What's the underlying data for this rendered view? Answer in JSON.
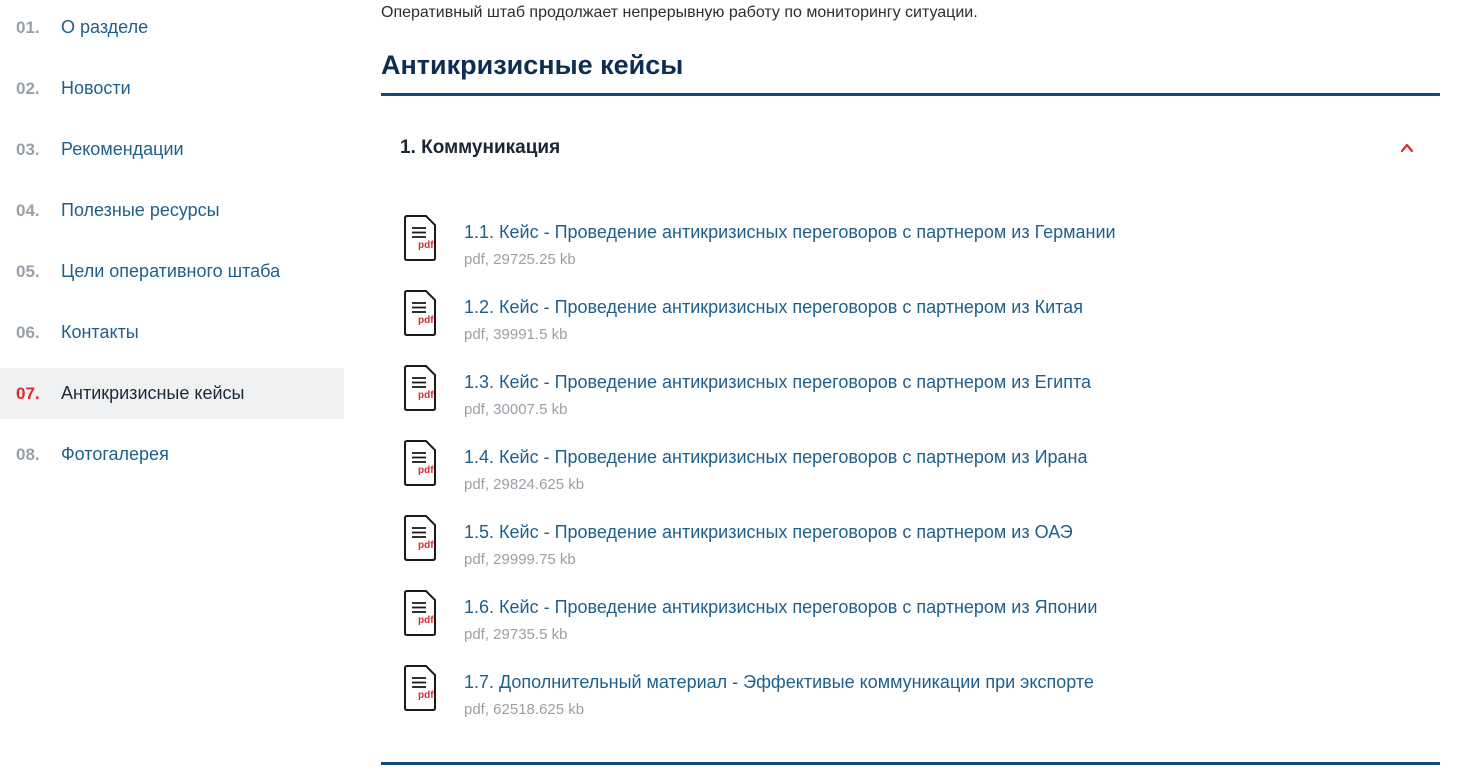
{
  "sidebar": {
    "items": [
      {
        "num": "01.",
        "label": "О разделе"
      },
      {
        "num": "02.",
        "label": "Новости"
      },
      {
        "num": "03.",
        "label": "Рекомендации"
      },
      {
        "num": "04.",
        "label": "Полезные ресурсы"
      },
      {
        "num": "05.",
        "label": "Цели оперативного штаба"
      },
      {
        "num": "06.",
        "label": "Контакты"
      },
      {
        "num": "07.",
        "label": "Антикризисные кейсы"
      },
      {
        "num": "08.",
        "label": "Фотогалерея"
      }
    ],
    "active_index": 6
  },
  "main": {
    "intro": "Оперативный штаб продолжает непрерывную работу по мониторингу ситуации.",
    "section_title": "Антикризисные кейсы",
    "accordion": {
      "title": "1. Коммуникация",
      "expanded": true,
      "files": [
        {
          "title": "1.1. Кейс - Проведение антикризисных переговоров с партнером из Германии",
          "meta": "pdf, 29725.25 kb"
        },
        {
          "title": "1.2. Кейс - Проведение антикризисных переговоров с партнером из Китая",
          "meta": "pdf, 39991.5 kb"
        },
        {
          "title": "1.3. Кейс - Проведение антикризисных переговоров с партнером из Египта",
          "meta": "pdf, 30007.5 kb"
        },
        {
          "title": "1.4. Кейс - Проведение антикризисных переговоров с партнером из Ирана",
          "meta": "pdf, 29824.625 kb"
        },
        {
          "title": "1.5. Кейс - Проведение антикризисных переговоров с партнером из ОАЭ",
          "meta": "pdf, 29999.75 kb"
        },
        {
          "title": "1.6. Кейс - Проведение антикризисных переговоров с партнером из Японии",
          "meta": "pdf, 29735.5 kb"
        },
        {
          "title": "1.7. Дополнительный материал - Эффективые коммуникации при экспорте",
          "meta": "pdf, 62518.625 kb"
        }
      ]
    }
  },
  "icons": {
    "file": "pdf-file-icon",
    "chevron": "chevron-up-icon",
    "pdf_label": "pdf"
  },
  "colors": {
    "accent_red": "#e0292e",
    "link_blue": "#1f5f8b",
    "heading_navy": "#0f2d53",
    "rule_blue": "#124a7d",
    "muted_gray": "#9aa0a7",
    "active_bg": "#f0f1f3"
  }
}
